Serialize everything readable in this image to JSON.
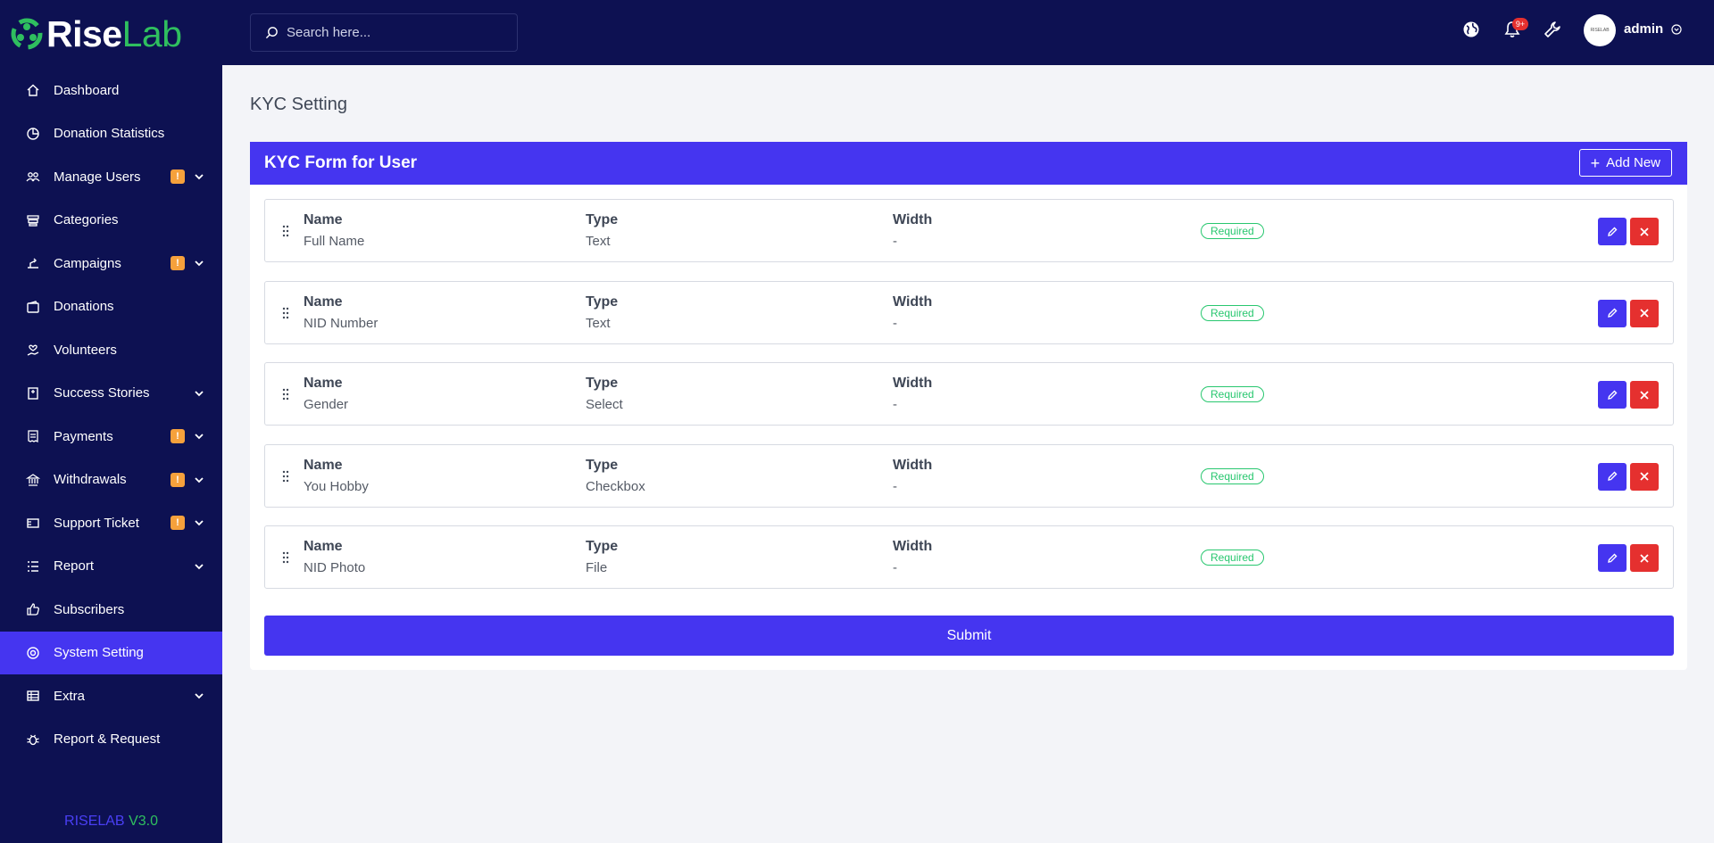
{
  "brand": {
    "logo_rise": "Rise",
    "logo_lab": "Lab",
    "version_name": "RISELAB",
    "version_num": "V3.0"
  },
  "sidebar": {
    "items": [
      {
        "label": "Dashboard",
        "icon": "home-icon"
      },
      {
        "label": "Donation Statistics",
        "icon": "pie-chart-icon"
      },
      {
        "label": "Manage Users",
        "icon": "users-icon",
        "badge": "!",
        "expandable": true
      },
      {
        "label": "Categories",
        "icon": "layers-icon"
      },
      {
        "label": "Campaigns",
        "icon": "campaign-icon",
        "badge": "!",
        "expandable": true
      },
      {
        "label": "Donations",
        "icon": "wallet-icon"
      },
      {
        "label": "Volunteers",
        "icon": "hand-heart-icon"
      },
      {
        "label": "Success Stories",
        "icon": "book-icon",
        "expandable": true
      },
      {
        "label": "Payments",
        "icon": "receipt-icon",
        "badge": "!",
        "expandable": true
      },
      {
        "label": "Withdrawals",
        "icon": "bank-icon",
        "badge": "!",
        "expandable": true
      },
      {
        "label": "Support Ticket",
        "icon": "ticket-icon",
        "badge": "!",
        "expandable": true
      },
      {
        "label": "Report",
        "icon": "list-icon",
        "expandable": true
      },
      {
        "label": "Subscribers",
        "icon": "thumbs-up-icon"
      },
      {
        "label": "System Setting",
        "icon": "settings-icon",
        "active": true
      },
      {
        "label": "Extra",
        "icon": "table-icon",
        "expandable": true
      },
      {
        "label": "Report & Request",
        "icon": "bug-icon"
      }
    ]
  },
  "topbar": {
    "search_placeholder": "Search here...",
    "notification_count": "9+",
    "avatar_text": "RISELAB",
    "user_name": "admin"
  },
  "page": {
    "title": "KYC Setting"
  },
  "card": {
    "title": "KYC Form for User",
    "add_button": "Add New",
    "submit_label": "Submit",
    "col_labels": {
      "name": "Name",
      "type": "Type",
      "width": "Width"
    },
    "rows": [
      {
        "name": "Full Name",
        "type": "Text",
        "width": "-",
        "status": "Required"
      },
      {
        "name": "NID Number",
        "type": "Text",
        "width": "-",
        "status": "Required"
      },
      {
        "name": "Gender",
        "type": "Select",
        "width": "-",
        "status": "Required"
      },
      {
        "name": "You Hobby",
        "type": "Checkbox",
        "width": "-",
        "status": "Required"
      },
      {
        "name": "NID Photo",
        "type": "File",
        "width": "-",
        "status": "Required"
      }
    ]
  },
  "colors": {
    "sidebar_bg": "#0d1152",
    "accent": "#4535f0",
    "danger": "#e5302f",
    "success": "#28c76f",
    "badge": "#f6a13c"
  }
}
